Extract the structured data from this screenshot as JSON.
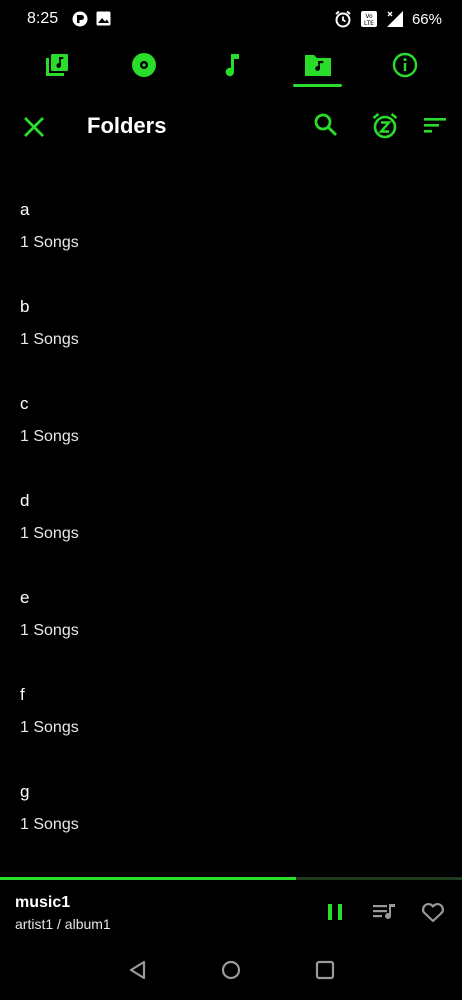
{
  "status": {
    "time": "8:25",
    "battery": "66%"
  },
  "tabs": [
    {
      "name": "playlists",
      "icon": "library-music-icon"
    },
    {
      "name": "albums",
      "icon": "album-disc-icon"
    },
    {
      "name": "songs",
      "icon": "music-note-icon"
    },
    {
      "name": "folders",
      "icon": "folder-music-icon",
      "selected": true
    },
    {
      "name": "info",
      "icon": "info-icon"
    }
  ],
  "toolbar": {
    "title": "Folders"
  },
  "folders": [
    {
      "name": "a",
      "count": "1 Songs"
    },
    {
      "name": "b",
      "count": "1 Songs"
    },
    {
      "name": "c",
      "count": "1 Songs"
    },
    {
      "name": "d",
      "count": "1 Songs"
    },
    {
      "name": "e",
      "count": "1 Songs"
    },
    {
      "name": "f",
      "count": "1 Songs"
    },
    {
      "name": "g",
      "count": "1 Songs"
    }
  ],
  "player": {
    "title": "music1",
    "subtitle": "artist1 / album1",
    "progress": 0.64
  },
  "colors": {
    "accent": "#2bdd2b",
    "background": "#000000"
  }
}
